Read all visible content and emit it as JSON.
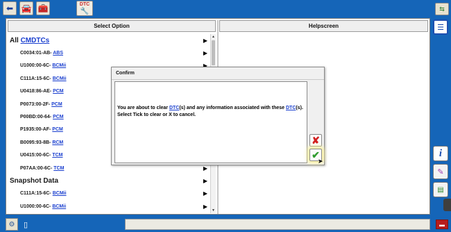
{
  "toolbar": {
    "back_icon": "back-arrow-icon",
    "vehicle_icon": "vehicle-icon",
    "toolbox_icon": "toolbox-icon",
    "dtc_tab_label": "DTC",
    "top_right_icon": "network-icon"
  },
  "left_pane": {
    "header": "Select Option",
    "rows": [
      {
        "type": "group",
        "prefix": "All ",
        "link": "CMDTCs"
      },
      {
        "type": "item",
        "prefix": "C0034:01-AB- ",
        "link": "ABS"
      },
      {
        "type": "item",
        "prefix": "U1000:00-6C- ",
        "link": "BCMii"
      },
      {
        "type": "item",
        "prefix": "C111A:15-6C- ",
        "link": "BCMii"
      },
      {
        "type": "item",
        "prefix": "U0418:86-AE- ",
        "link": "PCM"
      },
      {
        "type": "item",
        "prefix": "P0073:00-2F- ",
        "link": "PCM"
      },
      {
        "type": "item",
        "prefix": "P00BD:00-64- ",
        "link": "PCM"
      },
      {
        "type": "item",
        "prefix": "P1935:00-AF- ",
        "link": "PCM"
      },
      {
        "type": "item",
        "prefix": "B0095:93-8B- ",
        "link": "RCM"
      },
      {
        "type": "item",
        "prefix": "U0415:00-6C- ",
        "link": "TCM"
      },
      {
        "type": "item",
        "prefix": "P07AA:00-6C- ",
        "link": "TCM"
      },
      {
        "type": "group",
        "prefix": "Snapshot Data",
        "link": ""
      },
      {
        "type": "item",
        "prefix": "C111A:15-6C- ",
        "link": "BCMii"
      },
      {
        "type": "item",
        "prefix": "U1000:00-6C- ",
        "link": "BCMii"
      }
    ],
    "arrow_glyph": "▶"
  },
  "right_pane": {
    "header": "Helpscreen"
  },
  "right_toolbar": {
    "list_icon": "list-view-icon",
    "info_icon": "info-icon",
    "erase_icon": "erase-icon",
    "document_icon": "document-icon"
  },
  "dialog": {
    "title": "Confirm",
    "message_parts": [
      "You are about to clear ",
      "DTC",
      "(s) and any information associated with these ",
      "DTC",
      "(s). Select Tick to clear or X to cancel."
    ],
    "cancel_icon": "cancel-x-icon",
    "confirm_icon": "confirm-tick-icon"
  },
  "status": {
    "left_icon": "workshop-icon",
    "page_icon": "page-icon",
    "right_icon": "exit-icon"
  }
}
